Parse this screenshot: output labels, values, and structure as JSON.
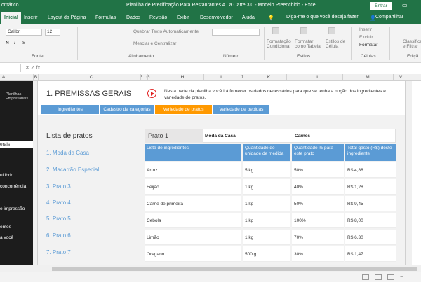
{
  "window": {
    "autosave_label": "omático",
    "autosave_state": "Off",
    "title": "Planilha de Precificação Para Restaurantes A La Carte 3.0 - Modelo Preenchido  -  Excel",
    "signin": "Entrar"
  },
  "ribbon": {
    "tabs": [
      "Inicial",
      "Inserir",
      "Layout da Página",
      "Fórmulas",
      "Dados",
      "Revisão",
      "Exibir",
      "Desenvolvedor",
      "Ajuda"
    ],
    "active_tab": "Inicial",
    "tell_me": "Diga-me o que você deseja fazer",
    "share": "Compartilhar",
    "font_name": "Calibri",
    "font_size": "12",
    "wrap_text": "Quebrar Texto Automaticamente",
    "merge_center": "Mesclar e Centralizar",
    "cond_format": "Formatação Condicional",
    "format_table": "Formatar como Tabela",
    "cell_styles": "Estilos de Célula",
    "insert": "Inserir",
    "delete": "Excluir",
    "format": "Formatar",
    "sort_filter": "Classificar e Filtrar",
    "bold": "N",
    "italic": "I",
    "underline": "S",
    "groups": {
      "font": "Fonte",
      "alignment": "Alinhamento",
      "number": "Número",
      "styles": "Estilos",
      "cells": "Células",
      "editing": "Ediçã"
    }
  },
  "formula_bar": {
    "fx_controls": "✕  ✓  fx",
    "content": ""
  },
  "columns": [
    "A",
    "B",
    "C",
    "F",
    "G",
    "H",
    "I",
    "J",
    "K",
    "L",
    "M",
    "V"
  ],
  "left_nav": {
    "logo_line1": "Planilhas",
    "logo_line2": "Empresariais",
    "items": [
      "erais",
      "uilíbrio",
      "concorrência",
      "e impressão",
      "entes",
      "a você"
    ],
    "active_index": 0
  },
  "main": {
    "section_title": "1. PREMISSAS GERAIS",
    "intro": "Nesta parte da planilha você irá fornecer os dados necessários para que se tenha a noção dos ingredientes e variedade de pratos.",
    "subtabs": [
      "Ingredientes",
      "Cadastro de categorias",
      "Variedade de pratos",
      "Variedade de bebidas"
    ],
    "active_subtab": 2
  },
  "dishes": {
    "title": "Lista de pratos",
    "items": [
      "1. Moda da Casa",
      "2. Macarrão Especial",
      "3. Prato 3",
      "4. Prato 4",
      "5. Prato 5",
      "6. Prato 6",
      "7. Prato 7"
    ]
  },
  "table": {
    "prato": "Prato 1",
    "dish_name": "Moda da Casa",
    "category": "Carnes",
    "headers": [
      "Lista de ingredientes",
      "Quantidade de unidade de medida",
      "Quantidade % para este prato",
      "Total gasto (R$) deste ingrediente"
    ],
    "rows": [
      [
        "Arroz",
        "5 kg",
        "50%",
        "R$ 4,88"
      ],
      [
        "Feijão",
        "1 kg",
        "40%",
        "R$ 1,28"
      ],
      [
        "Carne de primeira",
        "1 kg",
        "50%",
        "R$ 9,45"
      ],
      [
        "Cebola",
        "1 kg",
        "100%",
        "R$ 8,00"
      ],
      [
        "Limão",
        "1 kg",
        "70%",
        "R$ 6,30"
      ],
      [
        "Oregano",
        "500 g",
        "30%",
        "R$ 1,47"
      ]
    ]
  }
}
